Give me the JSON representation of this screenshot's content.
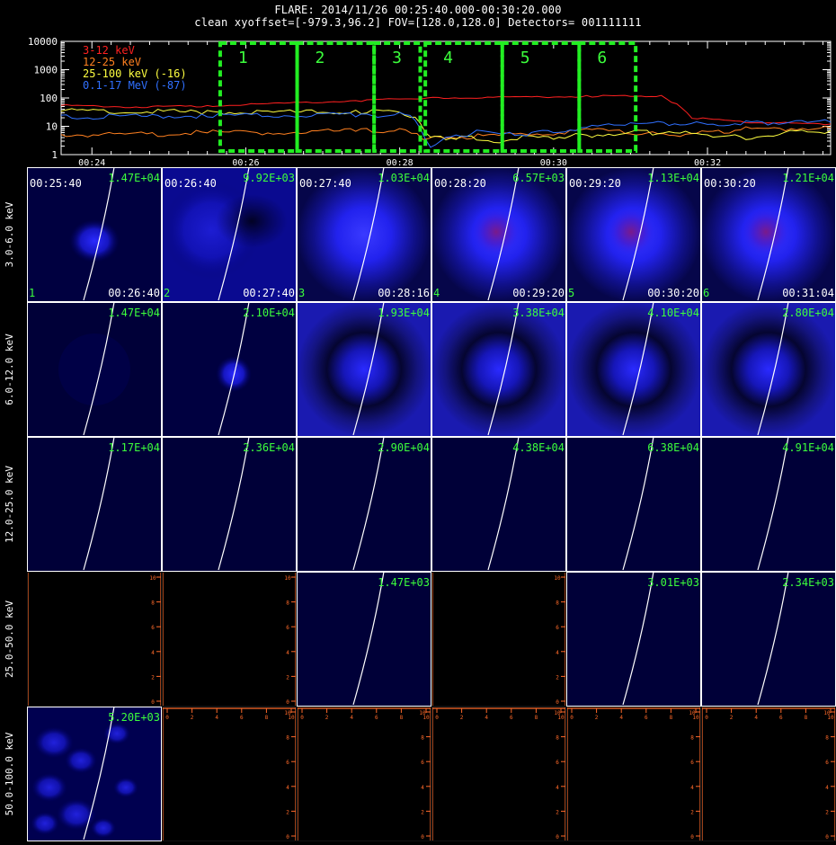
{
  "header": {
    "title": "FLARE: 2014/11/26 00:25:40.000-00:30:20.000",
    "subtitle": "clean    xyoffset=[-979.3,96.2]    FOV=[128.0,128.0]    Detectors= 001111111"
  },
  "chart_data": [
    {
      "type": "line",
      "y_scale": "log",
      "ylim": [
        1,
        10000
      ],
      "y_ticks": [
        "1",
        "10",
        "100",
        "1000",
        "10000"
      ],
      "x_ticks": [
        "00:24",
        "00:26",
        "00:28",
        "00:30",
        "00:32"
      ],
      "x_tick_values": [
        24,
        26,
        28,
        30,
        32
      ],
      "xlim": [
        23.6,
        33.6
      ],
      "series": [
        {
          "name": "3-12 keV",
          "color": "#ff2020",
          "x": [
            23.6,
            24.5,
            25.5,
            26.5,
            27.5,
            28.0,
            28.5,
            29.5,
            30.5,
            31.0,
            31.4,
            31.6,
            31.8,
            32.5,
            33.6
          ],
          "y": [
            55,
            48,
            52,
            65,
            80,
            95,
            100,
            105,
            115,
            120,
            115,
            60,
            20,
            14,
            12
          ]
        },
        {
          "name": "12-25 keV",
          "color": "#ff8020",
          "x": [
            23.6,
            24.5,
            25.5,
            26.5,
            27.5,
            28.0,
            28.3,
            28.6,
            29.5,
            30.5,
            31.0,
            31.5,
            32.0,
            32.5,
            33.6
          ],
          "y": [
            5,
            5,
            6,
            6,
            7,
            7,
            4,
            4,
            5,
            7,
            6,
            5,
            6,
            8,
            9
          ]
        },
        {
          "name": "25-100 keV (-16)",
          "color": "#ffff40",
          "x": [
            23.6,
            24.5,
            25.5,
            26.5,
            27.5,
            28.0,
            28.2,
            28.4,
            28.6,
            29.0,
            29.3,
            29.6,
            30.0,
            30.5,
            31.0,
            31.5,
            32.0,
            32.5,
            33.0,
            33.6
          ],
          "y": [
            35,
            33,
            32,
            31,
            32,
            32,
            20,
            4,
            4,
            4,
            2.5,
            4,
            4,
            5,
            6,
            6,
            5,
            4,
            6,
            7
          ]
        },
        {
          "name": "0.1-17 MeV (-87)",
          "color": "#3070ff",
          "x": [
            23.6,
            24.5,
            25.5,
            26.5,
            27.5,
            28.0,
            28.2,
            28.4,
            28.6,
            29.0,
            29.5,
            30.0,
            30.5,
            31.0,
            31.5,
            32.0,
            32.5,
            33.0,
            33.6
          ],
          "y": [
            22,
            22,
            24,
            24,
            25,
            26,
            20,
            2,
            4,
            6,
            5,
            7,
            10,
            12,
            13,
            12,
            14,
            13,
            14
          ]
        }
      ],
      "intervals": [
        {
          "label": "1",
          "start": 25.667,
          "end": 26.667
        },
        {
          "label": "2",
          "start": 26.667,
          "end": 27.667
        },
        {
          "label": "3",
          "start": 27.667,
          "end": 28.267
        },
        {
          "label": "4",
          "start": 28.333,
          "end": 29.333
        },
        {
          "label": "5",
          "start": 29.333,
          "end": 30.333
        },
        {
          "label": "6",
          "start": 30.333,
          "end": 31.067
        }
      ]
    },
    {
      "type": "heatmap",
      "energy_bands": [
        "3.0-6.0 keV",
        "6.0-12.0 keV",
        "12.0-25.0 keV",
        "25.0-50.0 keV",
        "50.0-100.0 keV"
      ],
      "time_starts": [
        "00:25:40",
        "00:26:40",
        "00:27:40",
        "00:28:20",
        "00:29:20",
        "00:30:20"
      ],
      "time_ends": [
        "00:26:40",
        "00:27:40",
        "00:28:16",
        "00:29:20",
        "00:30:20",
        "00:31:04"
      ],
      "interval_numbers": [
        "1",
        "2",
        "3",
        "4",
        "5",
        "6"
      ],
      "peak_values": [
        [
          "1.47E+04",
          "9.92E+03",
          "1.03E+04",
          "6.57E+03",
          "1.13E+04",
          "1.21E+04"
        ],
        [
          "1.47E+04",
          "2.10E+04",
          "1.93E+04",
          "3.38E+04",
          "4.10E+04",
          "2.80E+04"
        ],
        [
          "1.17E+04",
          "2.36E+04",
          "2.90E+04",
          "4.38E+04",
          "6.38E+04",
          "4.91E+04"
        ],
        [
          "",
          "",
          "1.47E+03",
          "",
          "3.01E+03",
          "2.34E+03"
        ],
        [
          "5.20E+03",
          "",
          "",
          "",
          "",
          ""
        ]
      ],
      "frame_ticks": [
        "0",
        "2",
        "4",
        "6",
        "8",
        "10"
      ]
    }
  ],
  "colors": {
    "header_text": "#ffffff",
    "label_green": "#3cff3c",
    "interval_box": "#22ee22",
    "axis_orange": "#ff6a2a",
    "limb_line": "#ffffff"
  }
}
